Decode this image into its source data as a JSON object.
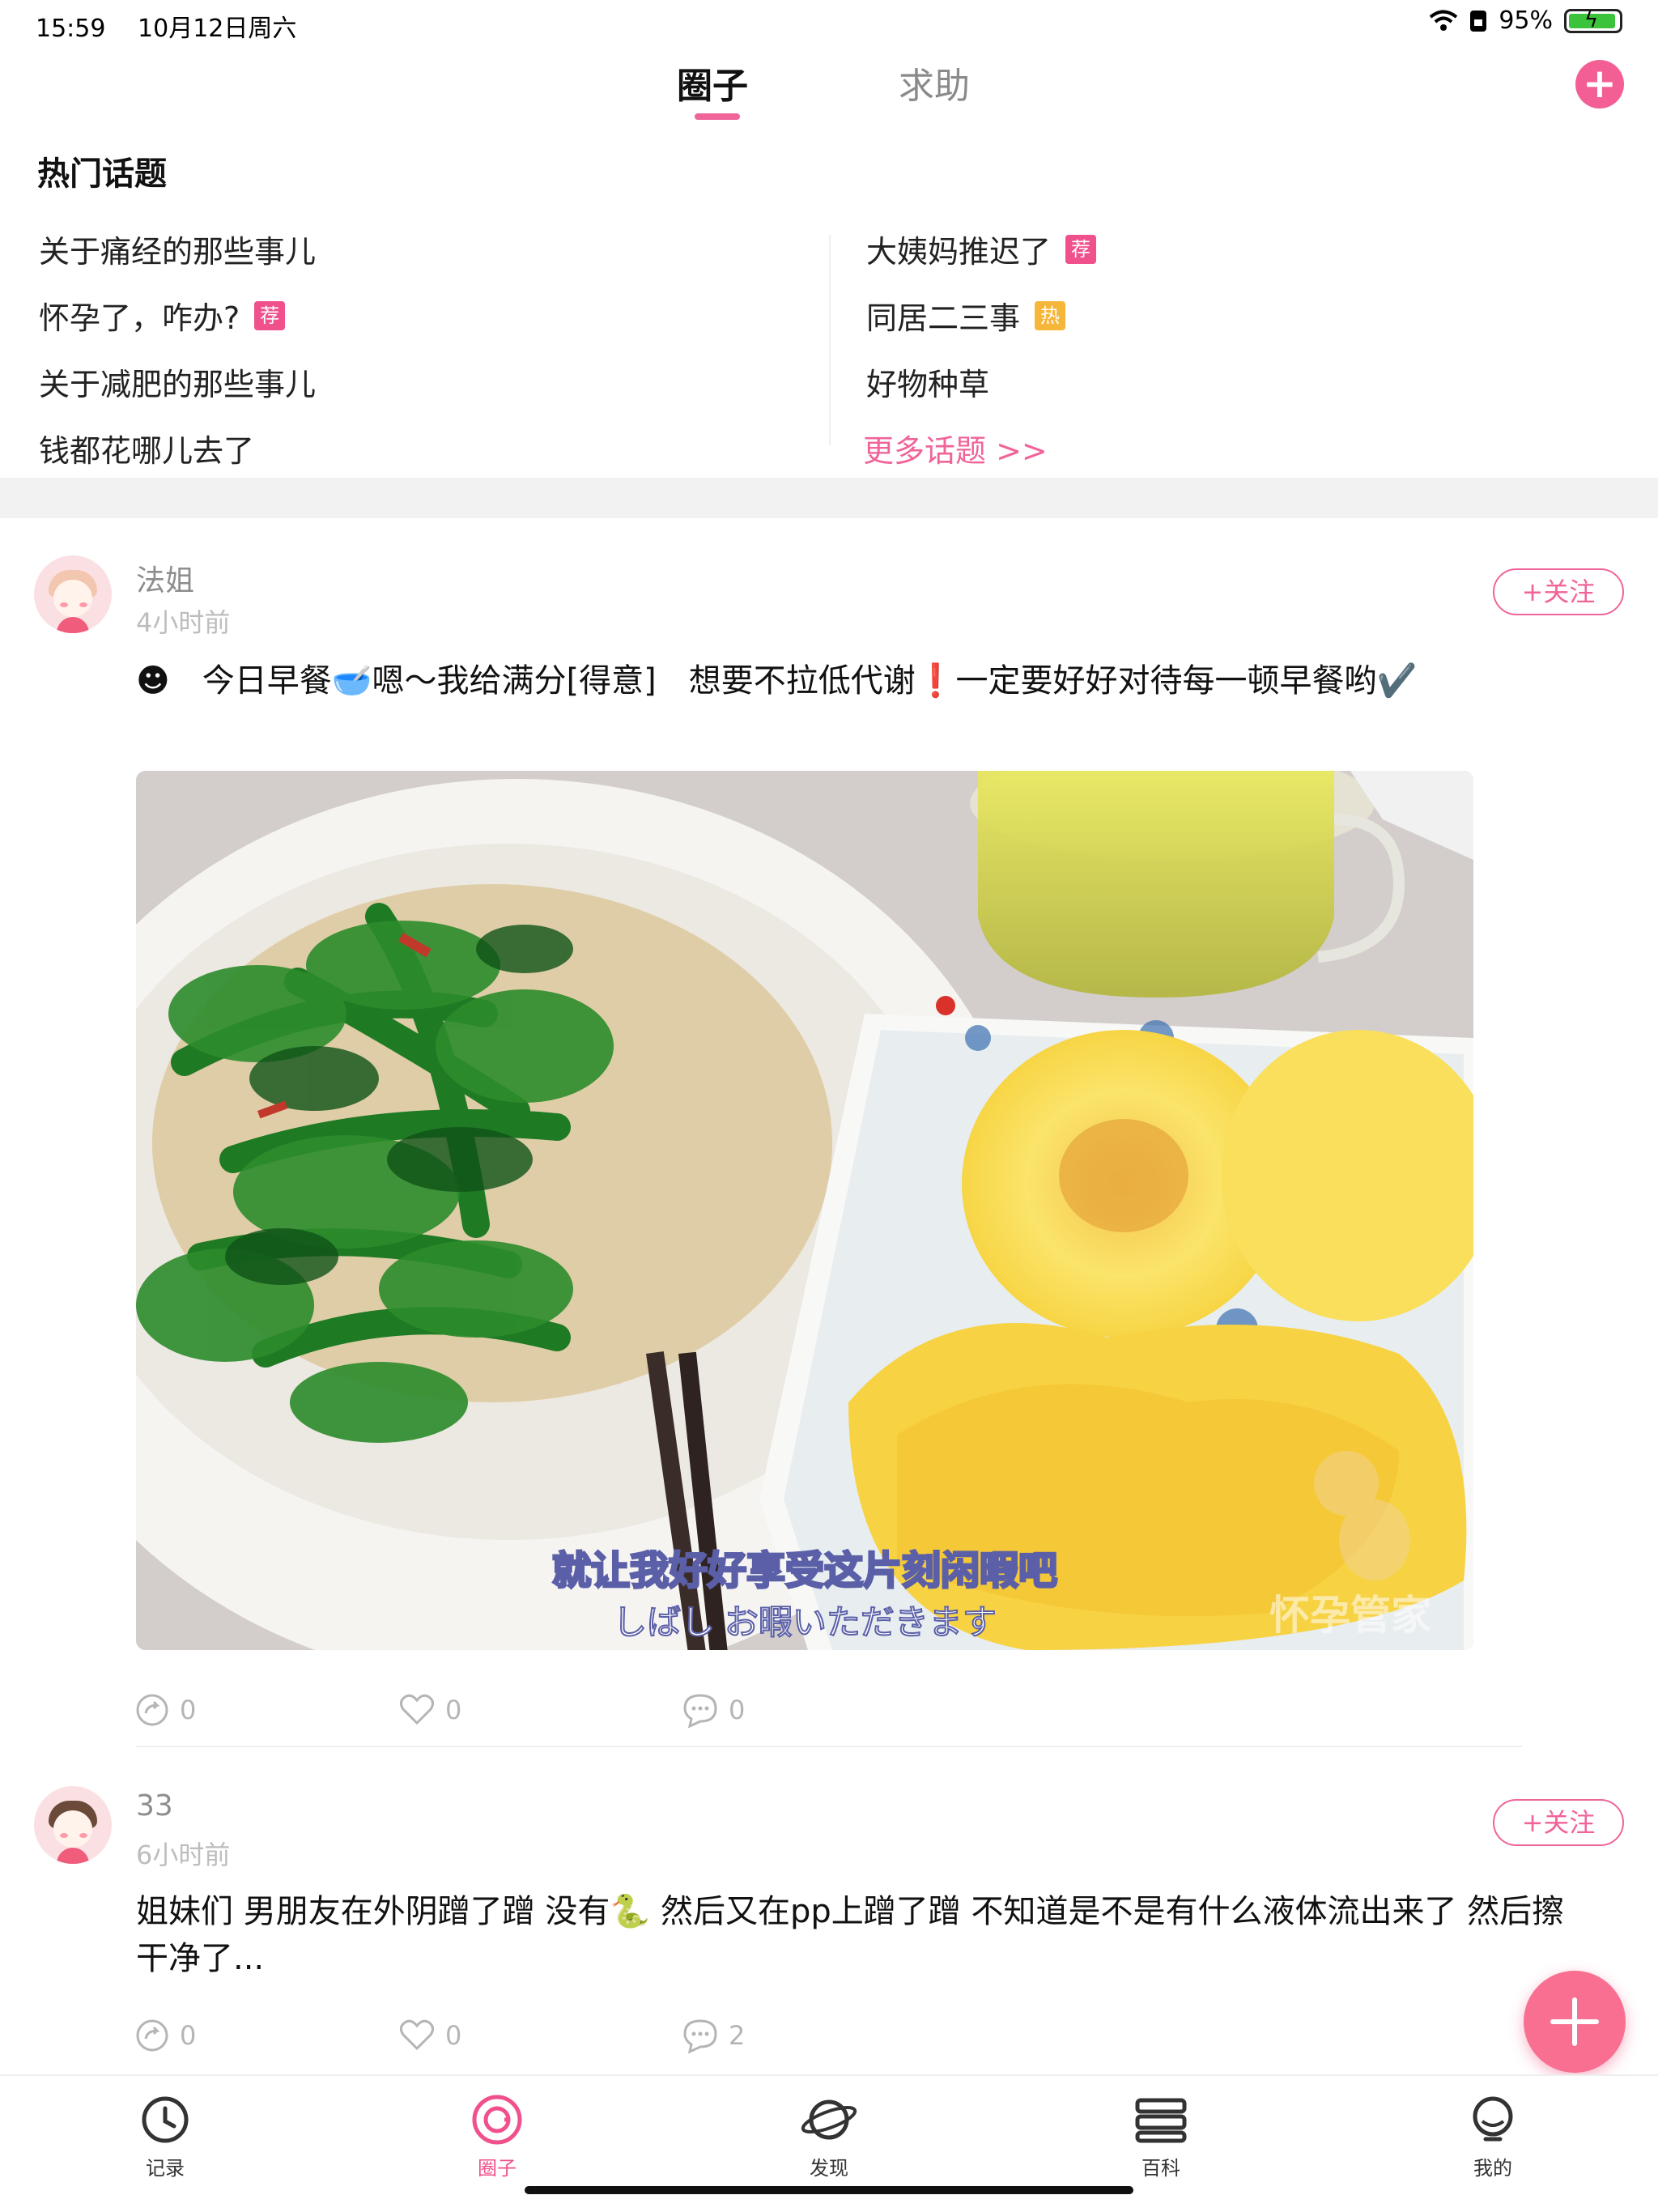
{
  "status_bar": {
    "time": "15:59",
    "date": "10月12日周六",
    "battery": "95%",
    "battery_level": 0.95
  },
  "top_tabs": {
    "active": "圈子",
    "inactive": "求助"
  },
  "hot_topics": {
    "title": "热门话题",
    "left": [
      {
        "label": "关于痛经的那些事儿",
        "badge": ""
      },
      {
        "label": "怀孕了，咋办?",
        "badge": "荐"
      },
      {
        "label": "关于减肥的那些事儿",
        "badge": ""
      },
      {
        "label": "钱都花哪儿去了",
        "badge": ""
      }
    ],
    "right": [
      {
        "label": "大姨妈推迟了",
        "badge": "荐"
      },
      {
        "label": "同居二三事",
        "badge": "热"
      },
      {
        "label": "好物种草",
        "badge": ""
      }
    ],
    "more": "更多话题 >>"
  },
  "posts": [
    {
      "username": "法姐",
      "time": "4小时前",
      "follow": "+关注",
      "text": "☻　今日早餐🥣嗯～我给满分[得意]　想要不拉低代谢❗️一定要好好对待每一顿早餐哟✔️",
      "image_caption_1": "就让我好好享受这片刻闲暇吧",
      "image_caption_2": "しばし お暇いただきます",
      "image_watermark": "怀孕管家",
      "shares": "0",
      "likes": "0",
      "comments": "0"
    },
    {
      "username": "33",
      "time": "6小时前",
      "follow": "+关注",
      "text": "姐妹们 男朋友在外阴蹭了蹭 没有🐍 然后又在pp上蹭了蹭 不知道是不是有什么液体流出来了 然后擦干净了...",
      "shares": "0",
      "likes": "0",
      "comments": "2"
    }
  ],
  "bottom_nav": [
    {
      "label": "记录",
      "icon": "clock-icon"
    },
    {
      "label": "圈子",
      "icon": "circle-icon"
    },
    {
      "label": "发现",
      "icon": "planet-icon"
    },
    {
      "label": "百科",
      "icon": "book-icon"
    },
    {
      "label": "我的",
      "icon": "profile-icon"
    }
  ],
  "colors": {
    "accent": "#f0649a",
    "badge_rec": "#f0508c",
    "badge_hot": "#f6b63a"
  }
}
